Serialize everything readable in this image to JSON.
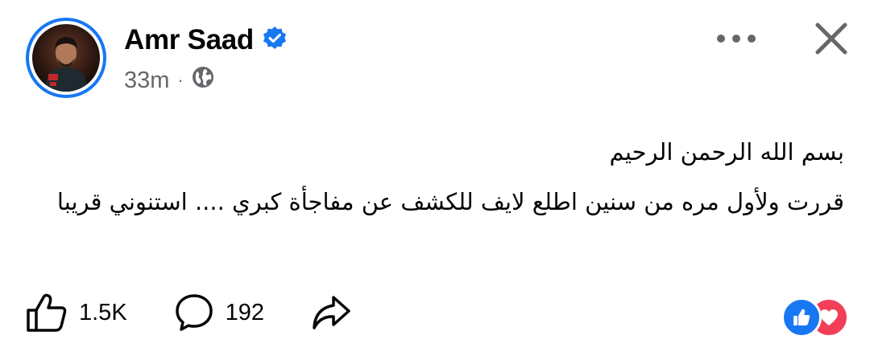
{
  "post": {
    "author": "Amr Saad",
    "verified": true,
    "time": "33m",
    "audience_icon": "globe-icon",
    "paragraphs": [
      "بسم الله الرحمن الرحيم",
      "قررت ولأول مره من سنين اطلع لايف للكشف عن مفاجأة كبري .... استنوني قريبا"
    ]
  },
  "actions": {
    "like_count": "1.5K",
    "comment_count": "192"
  },
  "reactions": [
    "like-reaction-icon",
    "love-reaction-icon"
  ],
  "colors": {
    "accent": "#1877f2",
    "love": "#f33e58",
    "secondary_text": "#65676b"
  }
}
